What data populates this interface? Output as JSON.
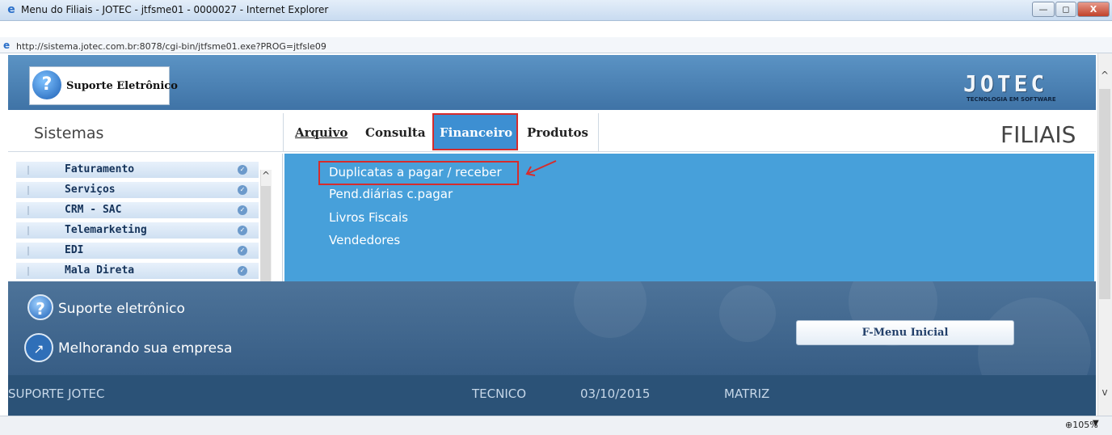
{
  "window": {
    "title": "Menu do Filiais - JOTEC - jtfsme01 - 0000027 - Internet Explorer",
    "url": "http://sistema.jotec.com.br:8078/cgi-bin/jtfsme01.exe?PROG=jtfsle09",
    "minimize": "—",
    "maximize": "◻",
    "close": "X"
  },
  "banner": {
    "support_label": "Suporte Eletrônico",
    "logo": "JOTEC",
    "logo_sub": "TECNOLOGIA EM SOFTWARE"
  },
  "header": {
    "sistemas": "Sistemas",
    "page_title": "FILIAIS"
  },
  "menu": {
    "arquivo": "Arquivo",
    "consulta": "Consulta",
    "financeiro": "Financeiro",
    "produtos": "Produtos"
  },
  "sidebar": {
    "items": [
      {
        "label": "Faturamento"
      },
      {
        "label": "Serviços"
      },
      {
        "label": "CRM - SAC"
      },
      {
        "label": "Telemarketing"
      },
      {
        "label": "EDI"
      },
      {
        "label": "Mala Direta"
      }
    ]
  },
  "dropdown": {
    "items": [
      {
        "label": "Duplicatas a pagar / receber"
      },
      {
        "label": "Pend.diárias c.pagar"
      },
      {
        "label": "Livros Fiscais"
      },
      {
        "label": "Vendedores"
      }
    ]
  },
  "footer": {
    "line1": "Suporte eletrônico",
    "line2": "Melhorando sua empresa",
    "button": "F-Menu Inicial"
  },
  "status": {
    "company": "SUPORTE JOTEC",
    "user": "TECNICO",
    "date": "03/10/2015",
    "branch": "MATRIZ"
  },
  "browser_status": {
    "zoom": "105%"
  }
}
